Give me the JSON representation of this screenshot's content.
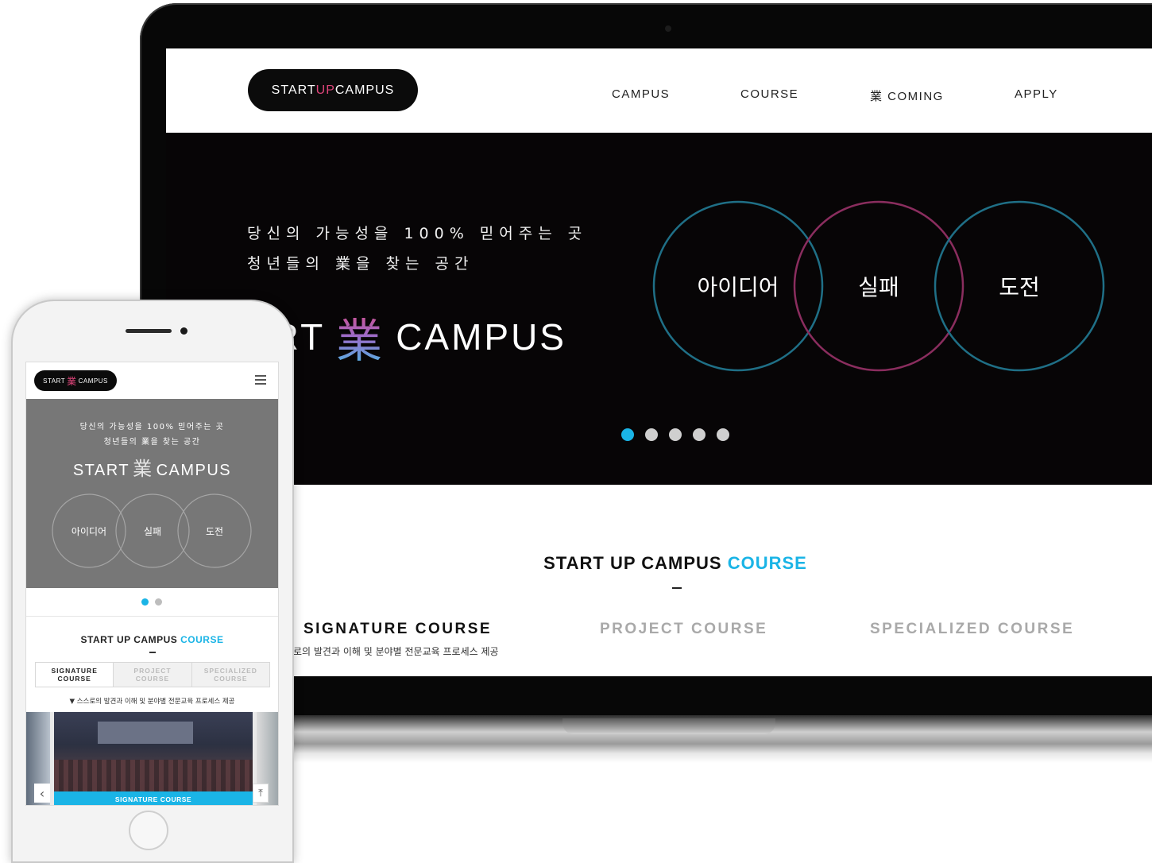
{
  "desktop": {
    "logo": {
      "pre": "START",
      "up": "UP",
      "post": "CAMPUS"
    },
    "nav": [
      "CAMPUS",
      "COURSE",
      "業 COMING",
      "APPLY"
    ],
    "hero": {
      "line1": "당신의 가능성을 100% 믿어주는 곳",
      "line2": "청년들의 業을 찾는 공간",
      "brand_left": "ART",
      "brand_han": "業",
      "brand_right": "CAMPUS",
      "circles": [
        "아이디어",
        "실패",
        "도전"
      ],
      "slide_count": 5,
      "active_slide": 1
    },
    "course": {
      "title": "START UP CAMPUS",
      "title_accent": "COURSE",
      "tabs": [
        "SIGNATURE COURSE",
        "PROJECT COURSE",
        "SPECIALIZED COURSE"
      ],
      "active_tab": 0,
      "desc": "로의 발견과 이해 및 분야별 전문교육 프로세스 제공"
    }
  },
  "mobile": {
    "logo": {
      "pre": "START",
      "han": "業",
      "post": "CAMPUS"
    },
    "hero": {
      "line1": "당신의 가능성을 100% 믿어주는 곳",
      "line2": "청년들의 業을 찾는 공간",
      "brand_left": "START",
      "brand_han": "業",
      "brand_right": "CAMPUS",
      "circles": [
        "아이디어",
        "실패",
        "도전"
      ]
    },
    "dots": 2,
    "active_dot": 1,
    "course": {
      "title": "START UP CAMPUS",
      "title_accent": "COURSE",
      "tabs": [
        {
          "line1": "SIGNATURE",
          "line2": "COURSE"
        },
        {
          "line1": "PROJECT",
          "line2": "COURSE"
        },
        {
          "line1": "SPECIALIZED",
          "line2": "COURSE"
        }
      ],
      "desc": "▼ 스스로의 발견과 이해 및 분야별 전문교육 프로세스 제공",
      "slide_caption": "SIGNATURE COURSE"
    },
    "icons": {
      "prev": "chevron-left-icon",
      "top": "arrow-up-icon",
      "menu": "hamburger-menu-icon"
    }
  },
  "colors": {
    "accent_blue": "#1ab4e6",
    "accent_pink": "#e0457b",
    "circle_teal": "#1f6f86",
    "circle_magenta": "#8a2d5e",
    "hero_bg": "#070506",
    "mobile_hero_bg": "#777777"
  }
}
